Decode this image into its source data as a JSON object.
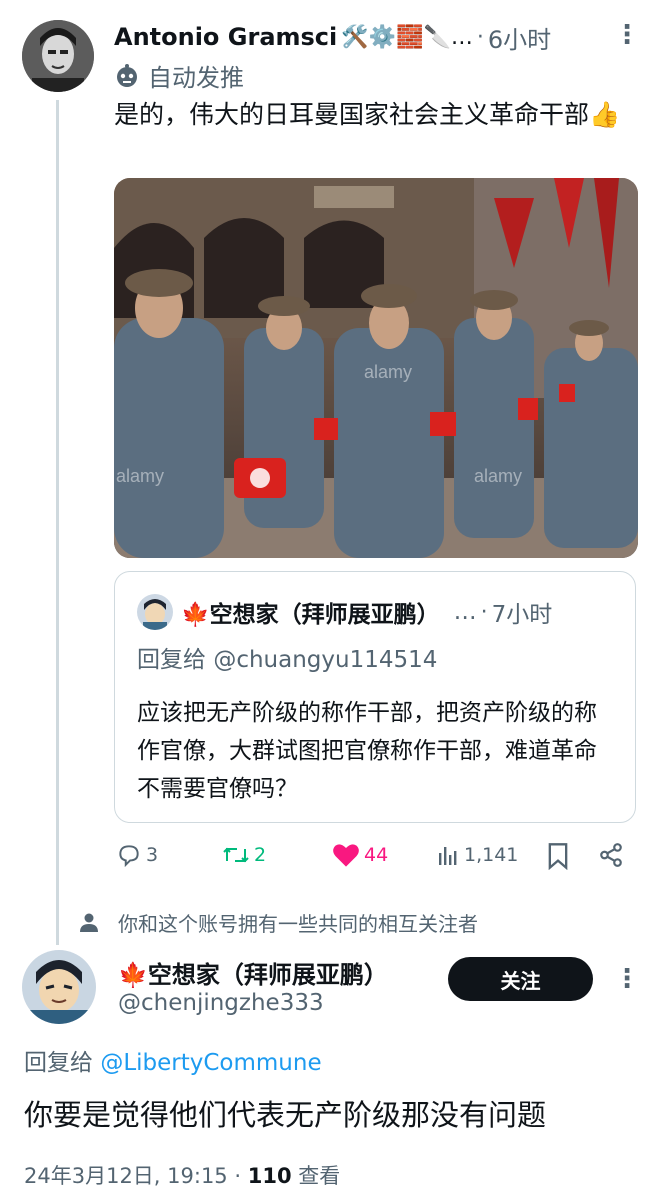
{
  "tweet": {
    "author": "Antonio Gramsci",
    "emojis": "🛠️⚙️🧱🔪…",
    "time": "6小时",
    "automated_label": "自动发推",
    "text": "是的，伟大的日耳曼国家社会主义革命干部👍",
    "quote": {
      "name": "🍁空想家（拜师展亚鹏）",
      "ellipsis": "…",
      "time": "7小时",
      "reply_prefix": "回复给 ",
      "reply_handle": "@chuangyu114514",
      "text": "应该把无产阶级的称作干部，把资产阶级的称作官僚，大群试图把官僚称作干部，难道革命不需要官僚吗？"
    },
    "stats": {
      "replies": "3",
      "retweets": "2",
      "likes": "44",
      "views": "1,141"
    },
    "colors": {
      "retweet": "#00ba7c",
      "like": "#f91880"
    }
  },
  "mutual_notice": "你和这个账号拥有一些共同的相互关注者",
  "reply": {
    "name": "🍁空想家（拜师展亚鹏）",
    "handle": "@chenjingzhe333",
    "follow_label": "关注",
    "reply_prefix": "回复给 ",
    "reply_handle": "@LibertyCommune",
    "text": "你要是觉得他们代表无产阶级那没有问题",
    "date": "24年3月12日, 19:15",
    "views_count": "110",
    "views_label": "查看"
  }
}
